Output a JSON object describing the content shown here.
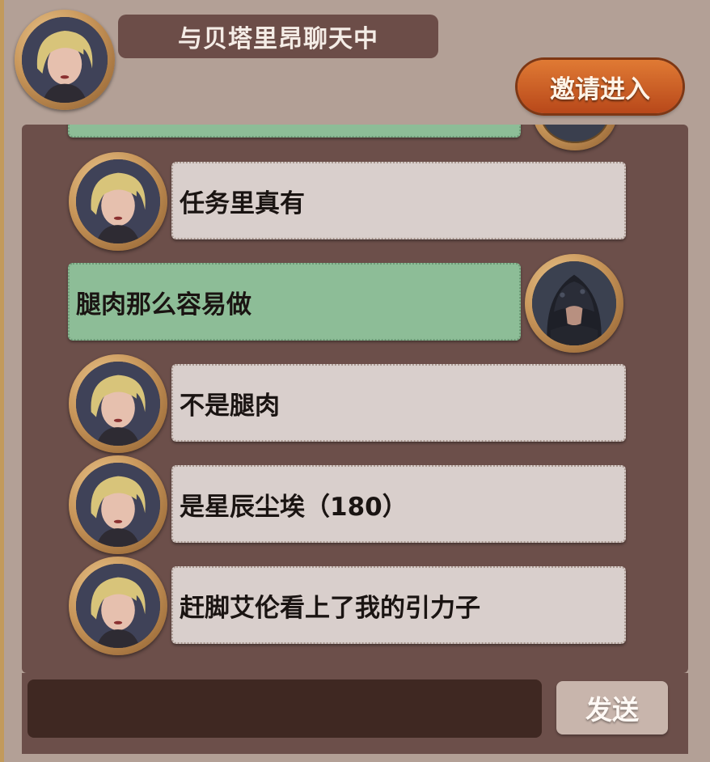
{
  "header": {
    "title": "与贝塔里昂聊天中",
    "invite_label": "邀请进入"
  },
  "messages": [
    {
      "sender": "other",
      "text": "任务里真有"
    },
    {
      "sender": "self",
      "text": "腿肉那么容易做"
    },
    {
      "sender": "other",
      "text": "不是腿肉"
    },
    {
      "sender": "other",
      "text": "是星辰尘埃（180）"
    },
    {
      "sender": "other",
      "text": "赶脚艾伦看上了我的引力子"
    }
  ],
  "input": {
    "value": "",
    "send_label": "发送"
  },
  "colors": {
    "background": "#b3a096",
    "panel": "#6c4f4a",
    "bubble_other": "#d9cfcc",
    "bubble_self": "#8dbd97",
    "invite_button": "#d0642a"
  }
}
